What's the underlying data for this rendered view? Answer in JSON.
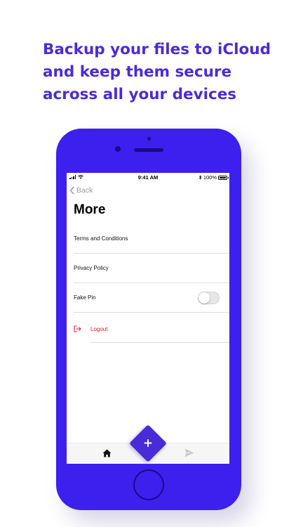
{
  "headline": {
    "line1": "Backup your files to iCloud",
    "line2": "and keep them secure",
    "line3": "across all your devices"
  },
  "colors": {
    "brand": "#4a2bd8",
    "phone_body": "#3d1fee",
    "logout": "#e0242a"
  },
  "status_bar": {
    "time": "9:41 AM",
    "battery": "100%"
  },
  "nav": {
    "back_label": "Back",
    "back_icon": "chevron-left-icon"
  },
  "page": {
    "title": "More"
  },
  "menu": {
    "items": [
      {
        "label": "Terms and Conditions"
      },
      {
        "label": "Privacy Policy"
      },
      {
        "label": "Fake Pin",
        "toggle": false
      }
    ],
    "logout": {
      "label": "Logout",
      "icon": "logout-icon"
    }
  },
  "tab_bar": {
    "home_icon": "home-icon",
    "fab_label": "+",
    "send_icon": "send-icon"
  }
}
